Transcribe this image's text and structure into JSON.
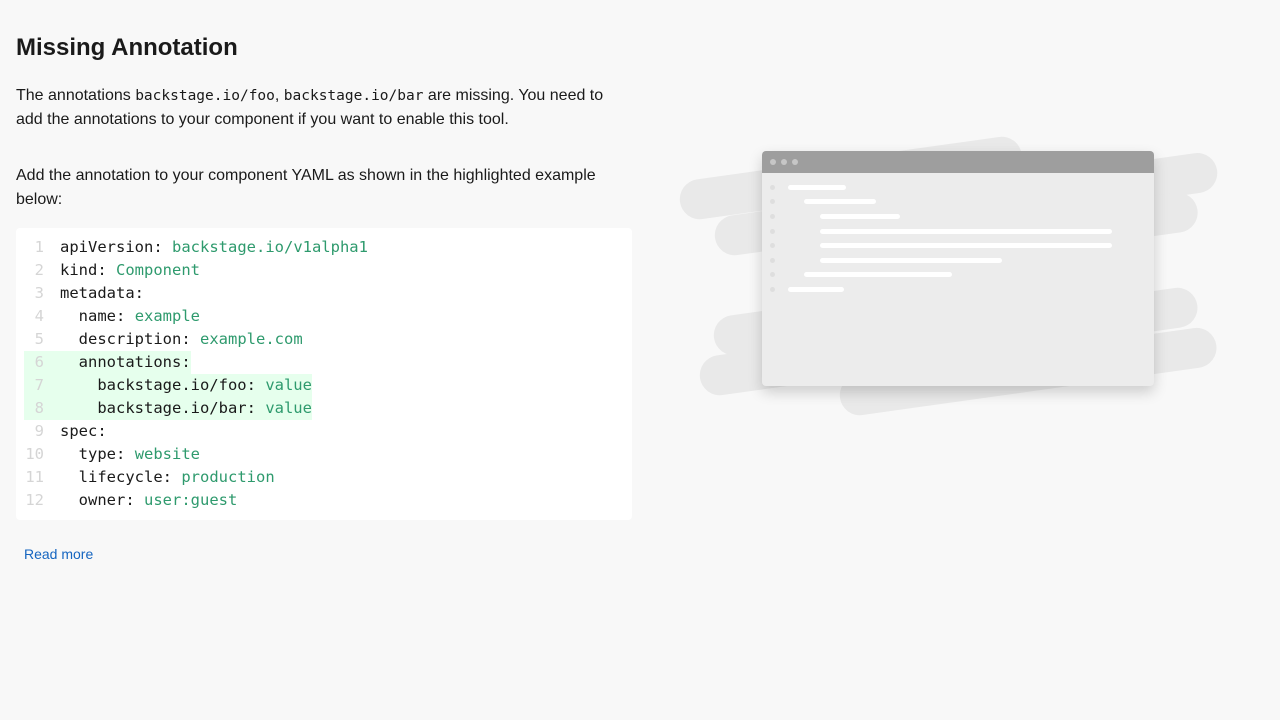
{
  "page": {
    "title": "Missing Annotation",
    "description": {
      "before": "The annotations ",
      "annotation_1": "backstage.io/foo",
      "separator": ", ",
      "annotation_2": "backstage.io/bar",
      "after": " are missing. You need to add the annotations to your component if you want to enable this tool."
    },
    "instruction": "Add the annotation to your component YAML as shown in the highlighted example below:",
    "read_more_label": "Read more"
  },
  "code": {
    "lines": [
      {
        "n": "1",
        "indent": "",
        "key": "apiVersion:",
        "value": "backstage.io/v1alpha1",
        "highlight": false
      },
      {
        "n": "2",
        "indent": "",
        "key": "kind:",
        "value": "Component",
        "highlight": false
      },
      {
        "n": "3",
        "indent": "",
        "key": "metadata:",
        "value": "",
        "highlight": false
      },
      {
        "n": "4",
        "indent": "  ",
        "key": "name:",
        "value": "example",
        "highlight": false
      },
      {
        "n": "5",
        "indent": "  ",
        "key": "description:",
        "value": "example.com",
        "highlight": false
      },
      {
        "n": "6",
        "indent": "  ",
        "key": "annotations:",
        "value": "",
        "highlight": true
      },
      {
        "n": "7",
        "indent": "    ",
        "key": "backstage.io/foo:",
        "value": "value",
        "highlight": true
      },
      {
        "n": "8",
        "indent": "    ",
        "key": "backstage.io/bar:",
        "value": "value",
        "highlight": true
      },
      {
        "n": "9",
        "indent": "",
        "key": "spec:",
        "value": "",
        "highlight": false
      },
      {
        "n": "10",
        "indent": "  ",
        "key": "type:",
        "value": "website",
        "highlight": false
      },
      {
        "n": "11",
        "indent": "  ",
        "key": "lifecycle:",
        "value": "production",
        "highlight": false
      },
      {
        "n": "12",
        "indent": "  ",
        "key": "owner:",
        "value": "user:guest",
        "highlight": false
      }
    ]
  },
  "colors": {
    "background": "#f8f8f8",
    "code_value": "#2e9a6d",
    "highlight": "#e6ffed",
    "link": "#1565c0"
  },
  "illustration": {
    "icon": "browser-window-illustration"
  }
}
